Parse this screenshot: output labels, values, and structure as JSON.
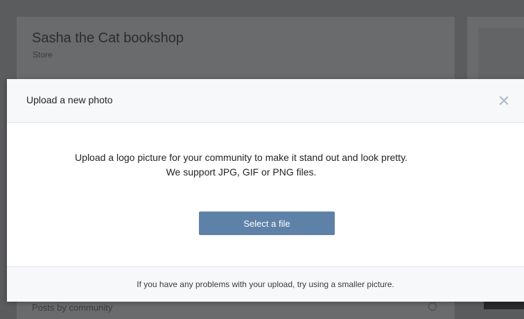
{
  "background_page": {
    "community_name": "Sasha the Cat bookshop",
    "community_type": "Store",
    "posts_label": "Posts by community"
  },
  "modal": {
    "title": "Upload a new photo",
    "description_line1": "Upload a logo picture for your community to make it stand out and look pretty.",
    "description_line2": "We support JPG, GIF or PNG files.",
    "select_button_label": "Select a file",
    "footer_text": "If you have any problems with your upload, try using a smaller picture.",
    "close_icon": "close-icon"
  },
  "colors": {
    "accent_button": "#5e81a8",
    "overlay_bg": "#5b5c5e",
    "modal_header_bg": "#f7f8fa"
  }
}
